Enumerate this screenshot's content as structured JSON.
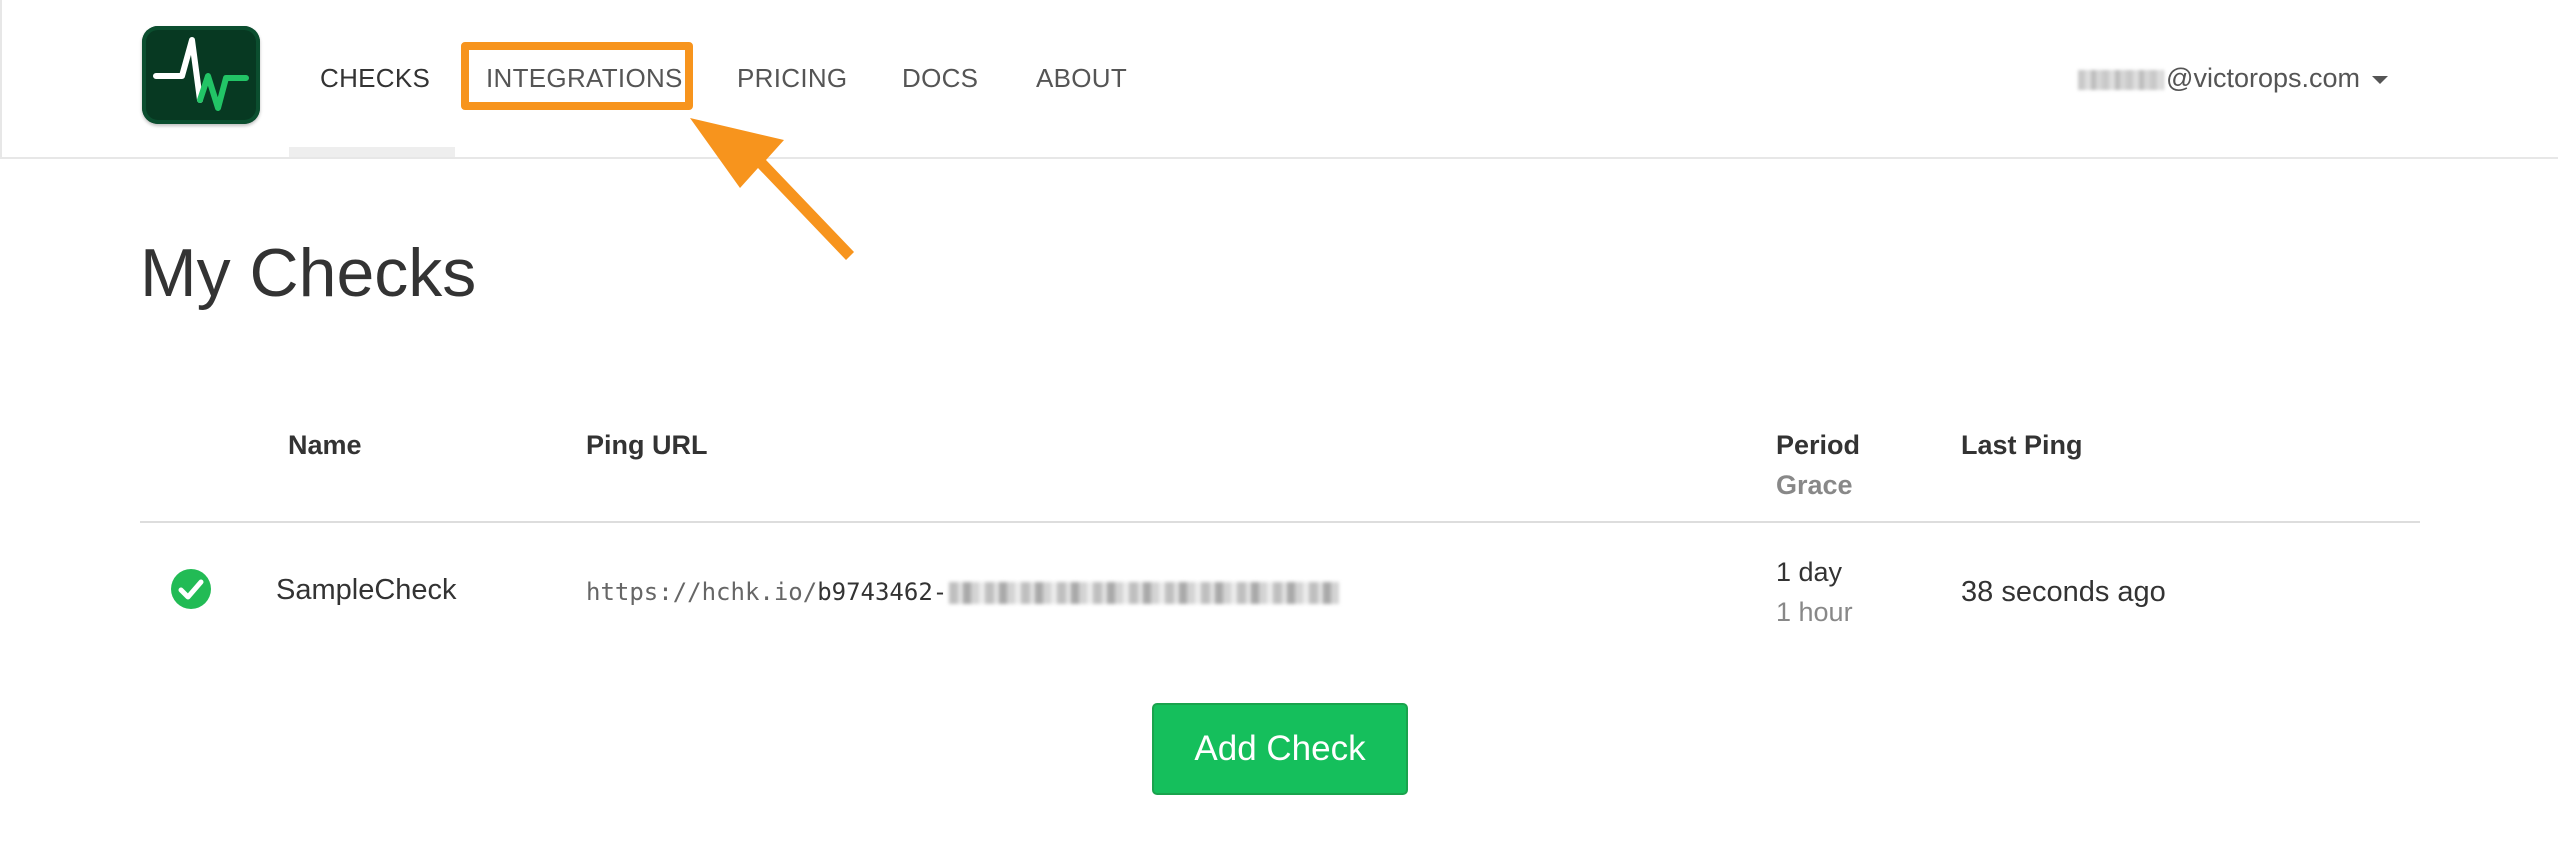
{
  "nav": {
    "items": [
      {
        "label": "CHECKS",
        "active": true
      },
      {
        "label": "INTEGRATIONS",
        "highlighted": true
      },
      {
        "label": "PRICING"
      },
      {
        "label": "DOCS"
      },
      {
        "label": "ABOUT"
      }
    ],
    "user_email_domain": "@victorops.com",
    "highlight_color": "#f7941d"
  },
  "page": {
    "title": "My Checks"
  },
  "table": {
    "headers": {
      "name": "Name",
      "ping_url": "Ping URL",
      "period": "Period",
      "grace": "Grace",
      "last_ping": "Last Ping"
    },
    "rows": [
      {
        "status": "up",
        "status_icon": "check-circle-icon",
        "name": "SampleCheck",
        "ping_url_prefix": "https://hchk.io/",
        "ping_url_id_visible": "b9743462-",
        "period": "1 day",
        "grace": "1 hour",
        "last_ping": "38 seconds ago"
      }
    ]
  },
  "actions": {
    "add_check_label": "Add Check"
  },
  "colors": {
    "accent_green": "#15bf5c",
    "status_up": "#22bb55",
    "logo_bg": "#073922"
  }
}
